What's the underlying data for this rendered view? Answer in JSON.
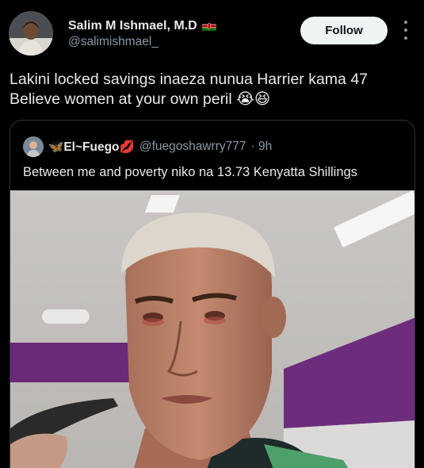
{
  "tweet": {
    "author": {
      "name": "Salim M Ishmael, M.D",
      "handle": "@salimishmael_",
      "flag_icon": "kenya-flag-icon"
    },
    "follow_label": "Follow",
    "text_lines": [
      "Lakini locked savings inaeza nunua Harrier kama 47",
      "Believe women at your own peril 😭😆"
    ]
  },
  "quoted_tweet": {
    "author_name": "El~Fuego",
    "name_prefix_emoji": "🦋",
    "name_suffix_emoji": "💋",
    "handle": "@fuegoshawrry777",
    "time": "· 9h",
    "text": "Between me and poverty niko na 13.73 Kenyatta Shillings",
    "image_description_icon": "crying-man-photo"
  },
  "colors": {
    "background": "#000000",
    "text_primary": "#e7e9ea",
    "text_secondary": "#8b98a5",
    "follow_bg": "#eff3f4",
    "border": "#2f3336"
  }
}
